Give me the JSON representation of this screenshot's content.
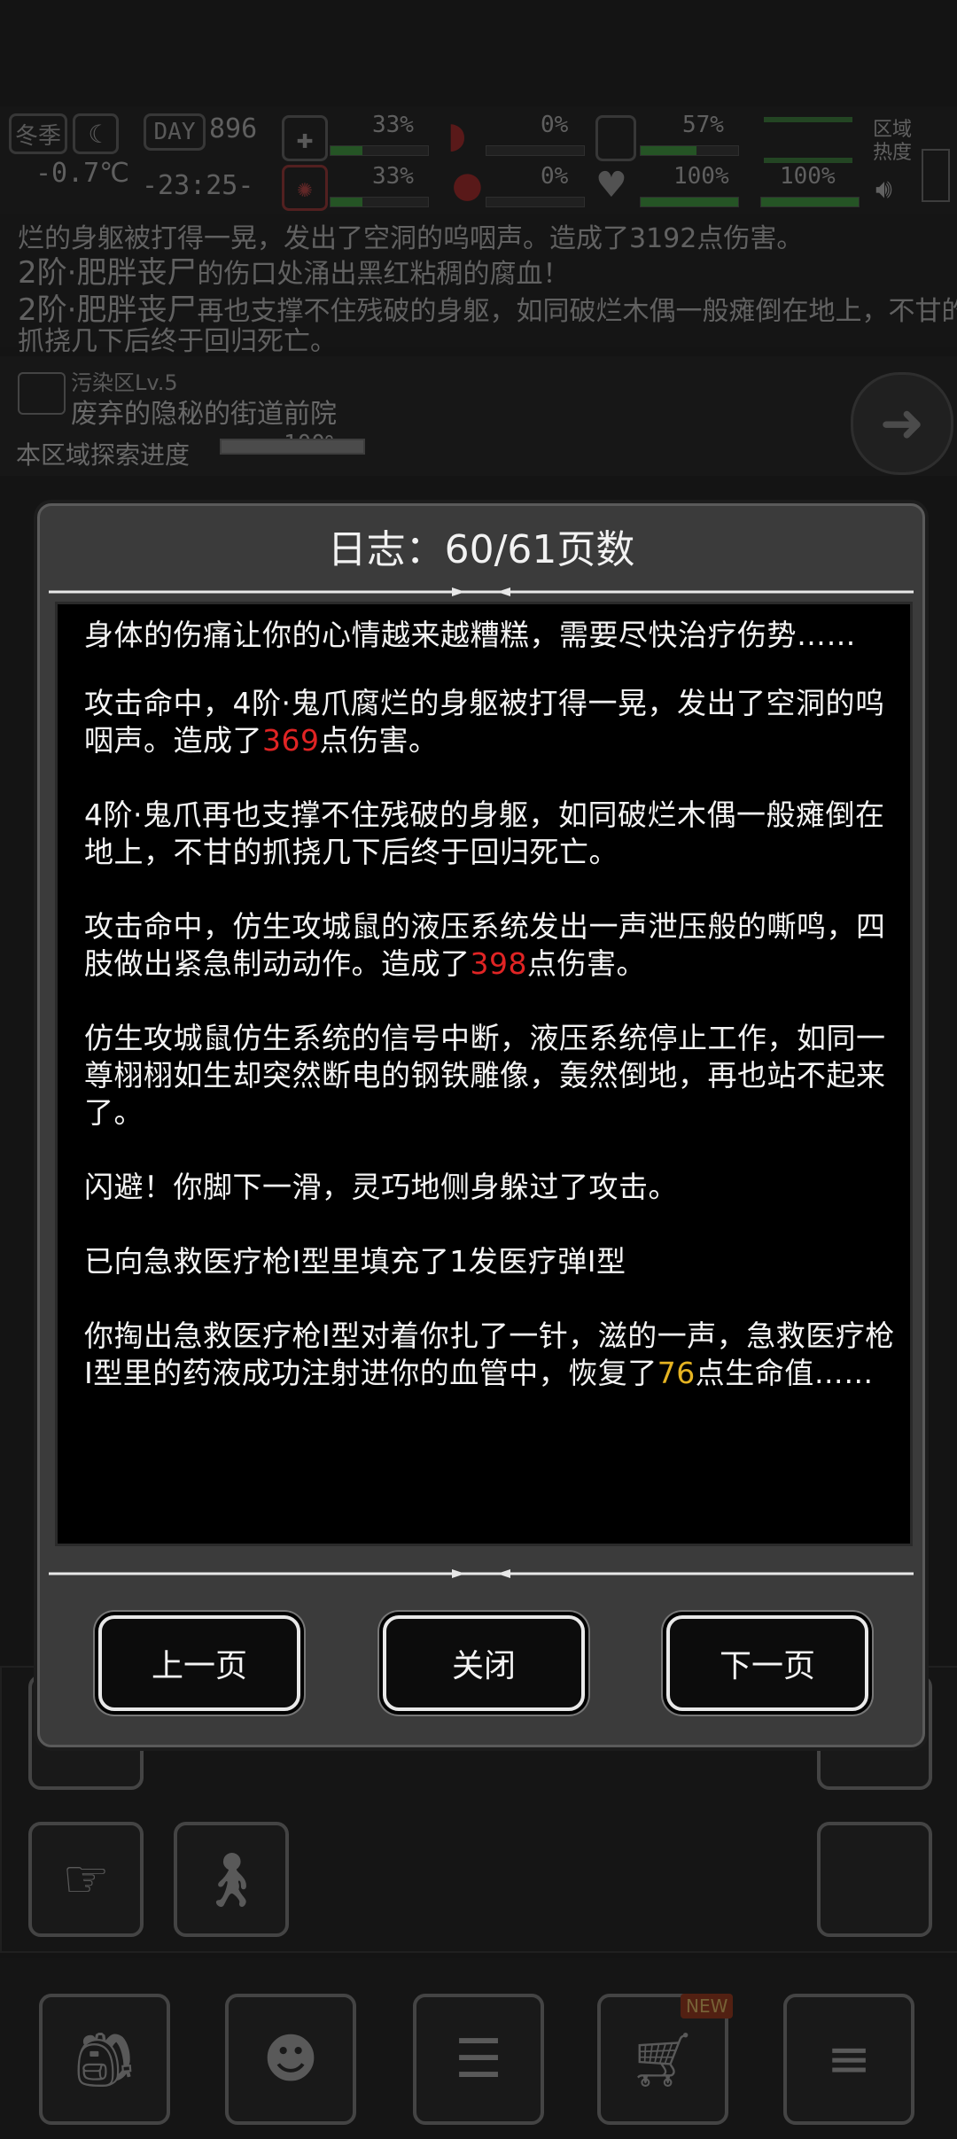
{
  "hud": {
    "season": "冬季",
    "temperature": "-0.7℃",
    "day_label": "DAY",
    "day_number": "896",
    "time": "-23:25-",
    "stat_1_top": "33%",
    "stat_1_bottom": "33%",
    "stat_2_top": "0%",
    "stat_2_bottom": "0%",
    "stat_3_top": "57%",
    "stat_3_bottom": "100%",
    "stat_4_bottom": "100%",
    "region_heat": "区域\n热度"
  },
  "background_log": {
    "line_1": "烂的身躯被打得一晃，发出了空洞的呜咽声。造成了3192点伤害。",
    "line_2_name": "2阶·肥胖丧尸",
    "line_2_text": "的伤口处涌出黑红粘稠的腐血！",
    "line_3_name": "2阶·肥胖丧尸",
    "line_3_text": "再也支撑不住残破的身躯，如同破烂木偶一般瘫倒在地上，不甘的",
    "line_4": "抓挠几下后终于回归死亡。"
  },
  "zone": {
    "level": "污染区Lv.5",
    "name": "废弃的隐秘的街道前院",
    "progress_label": "本区域探索进度",
    "progress_value": "100%",
    "progress_fraction": 1.0
  },
  "modal": {
    "title": "日志：60/61页数",
    "entries": {
      "e1": "身体的伤痛让你的心情越来越糟糕，需要尽快治疗伤势……",
      "e2_a": "攻击命中，4阶·鬼爪腐烂的身躯被打得一晃，发出了空洞的呜咽声。造成了",
      "e2_num": "369",
      "e2_b": "点伤害。",
      "e3": "4阶·鬼爪再也支撑不住残破的身躯，如同破烂木偶一般瘫倒在地上，不甘的抓挠几下后终于回归死亡。",
      "e4_a": "攻击命中，仿生攻城鼠的液压系统发出一声泄压般的嘶鸣，四肢做出紧急制动动作。造成了",
      "e4_num": "398",
      "e4_b": "点伤害。",
      "e5": "仿生攻城鼠仿生系统的信号中断，液压系统停止工作，如同一尊栩栩如生却突然断电的钢铁雕像，轰然倒地，再也站不起来了。",
      "e6": "闪避！你脚下一滑，灵巧地侧身躲过了攻击。",
      "e7": "已向急救医疗枪I型里填充了1发医疗弹I型",
      "e8_a": "你掏出急救医疗枪I型对着你扎了一针，滋的一声，急救医疗枪I型里的药液成功注射进你的血管中，恢复了",
      "e8_num": "76",
      "e8_b": "点生命值……"
    },
    "buttons": {
      "prev": "上一页",
      "close": "关闭",
      "next": "下一页"
    }
  },
  "colors": {
    "damage_number": "#e02424",
    "heal_number": "#e6b422",
    "hud_green": "#3fae3f"
  },
  "icons": [
    "moon-icon",
    "medkit-icon",
    "heart-icon",
    "stomach-icon",
    "water-drop-icon",
    "lungs-icon",
    "sound-icon",
    "arrow-right-icon",
    "backpack-icon",
    "brain-icon",
    "notebook-icon",
    "cart-icon",
    "menu-icon",
    "walk-icon",
    "tap-icon"
  ],
  "badge": {
    "new": "NEW"
  }
}
